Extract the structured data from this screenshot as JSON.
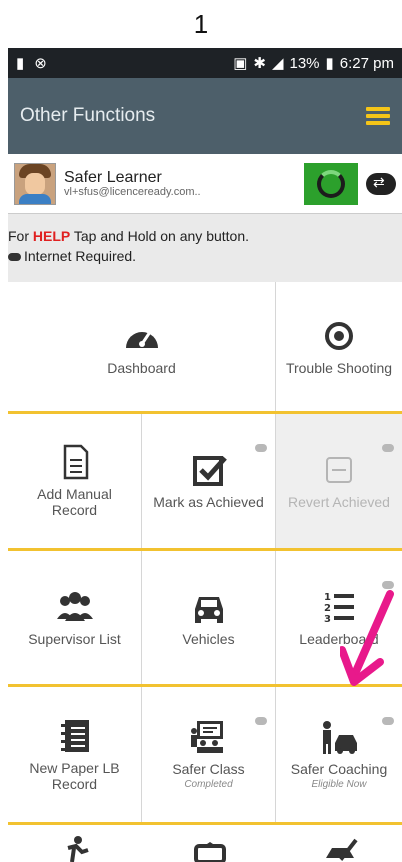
{
  "page_number": "1",
  "status_bar": {
    "battery_pct": "13%",
    "time": "6:27 pm"
  },
  "app_bar": {
    "title": "Other Functions"
  },
  "user": {
    "name": "Safer Learner",
    "email": "vl+sfus@licenceready.com.."
  },
  "help": {
    "prefix": "For ",
    "keyword": "HELP",
    "suffix": " Tap and Hold on any button.",
    "internet": "Internet Required."
  },
  "tiles": {
    "dashboard": "Dashboard",
    "trouble": "Trouble Shooting",
    "add_manual": "Add Manual Record",
    "mark_achieved": "Mark as Achieved",
    "revert_achieved": "Revert Achieved",
    "supervisor_list": "Supervisor List",
    "vehicles": "Vehicles",
    "leaderboard": "Leaderboard",
    "new_paper": "New Paper LB Record",
    "safer_class": "Safer Class",
    "safer_class_status": "Completed",
    "safer_coaching": "Safer Coaching",
    "safer_coaching_status": "Eligible Now"
  },
  "colors": {
    "accent": "#f2c230",
    "appbar": "#4d5f6a",
    "sync": "#2ca02c",
    "help": "#e02020",
    "arrow": "#e8198b"
  }
}
